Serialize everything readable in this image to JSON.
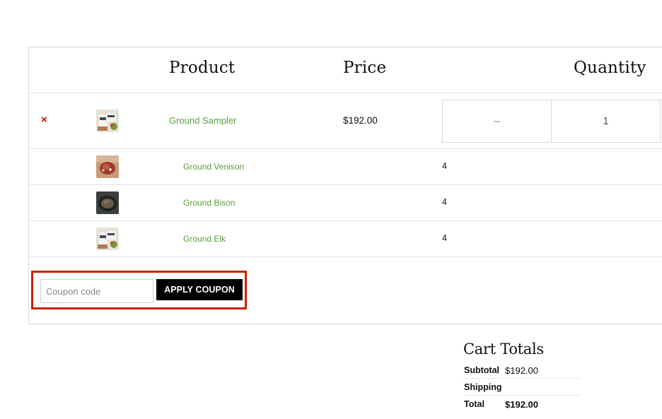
{
  "table": {
    "headers": {
      "product": "Product",
      "price": "Price",
      "quantity": "Quantity"
    },
    "main_item": {
      "remove_glyph": "×",
      "name": "Ground Sampler",
      "price": "$192.00",
      "qty_minus": "–",
      "qty_value": "1",
      "thumb_icon": "sampler-product-icon"
    },
    "sub_items": [
      {
        "name": "Ground Venison",
        "qty": "4",
        "thumb_icon": "venison-product-icon"
      },
      {
        "name": "Ground Bison",
        "qty": "4",
        "thumb_icon": "bison-product-icon"
      },
      {
        "name": "Ground Elk",
        "qty": "4",
        "thumb_icon": "elk-product-icon"
      }
    ]
  },
  "coupon": {
    "placeholder": "Coupon code",
    "value": "",
    "button_label": "APPLY COUPON",
    "highlight_color": "#cc2200"
  },
  "totals": {
    "title": "Cart Totals",
    "rows": [
      {
        "label": "Subtotal",
        "value": "$192.00"
      },
      {
        "label": "Shipping",
        "value": ""
      },
      {
        "label": "Total",
        "value": "$192.00"
      }
    ]
  },
  "colors": {
    "link_green": "#5b9d3e",
    "remove_red": "#d40000",
    "button_black": "#000000"
  }
}
